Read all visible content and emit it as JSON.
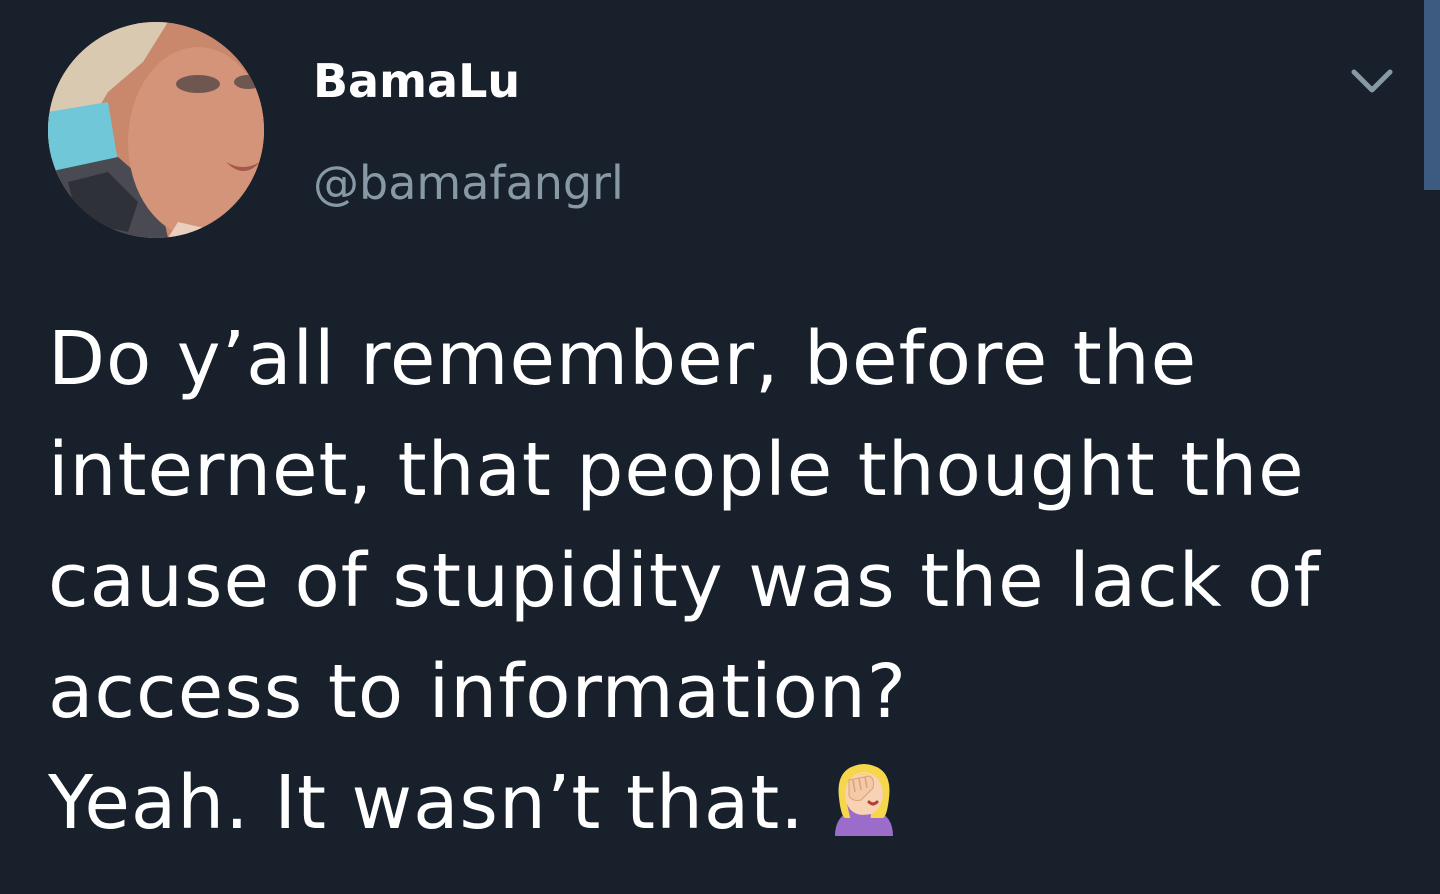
{
  "tweet": {
    "display_name": "BamaLu",
    "handle": "@bamafangrl",
    "lines": [
      "Do y’all remember, before the",
      "internet, that people thought the",
      "cause of stupidity was the lack of",
      "access to information?",
      "Yeah.  It wasn’t that."
    ],
    "emoji": "woman-facepalming-icon"
  },
  "colors": {
    "background": "#17202b",
    "text": "#ffffff",
    "secondary_text": "#8899a6",
    "scrollbar": "#3d5a80"
  }
}
